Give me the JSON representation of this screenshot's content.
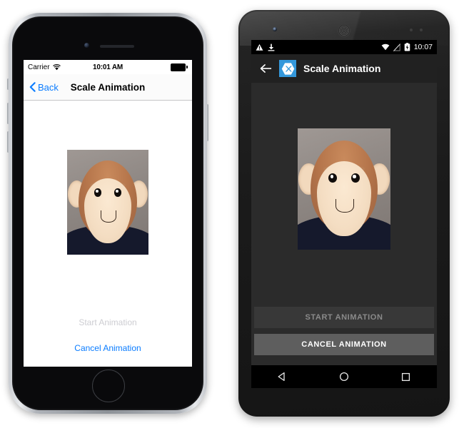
{
  "page": {
    "title": "Scale Animation — iOS and Android side by side"
  },
  "ios": {
    "status_bar": {
      "carrier": "Carrier",
      "wifi_icon": "wifi-icon",
      "time": "10:01 AM",
      "battery_icon": "battery-full-icon"
    },
    "nav_bar": {
      "back_label": "Back",
      "back_icon": "chevron-left-icon",
      "title": "Scale Animation"
    },
    "content": {
      "image_alt": "monkey-photo"
    },
    "actions": {
      "start_label": "Start Animation",
      "start_enabled": false,
      "cancel_label": "Cancel Animation",
      "cancel_enabled": true
    },
    "hardware": {
      "home_button": "home-button",
      "camera": "front-camera",
      "speaker": "earpiece-speaker"
    }
  },
  "android": {
    "status_bar": {
      "warning_icon": "warning-triangle-icon",
      "download_icon": "download-icon",
      "wifi_icon": "wifi-icon",
      "signal_icon": "no-sim-icon",
      "battery_icon": "battery-charging-icon",
      "time": "10:07"
    },
    "app_bar": {
      "back_icon": "arrow-left-icon",
      "logo_icon": "xamarin-logo-icon",
      "title": "Scale Animation"
    },
    "content": {
      "image_alt": "monkey-photo"
    },
    "actions": {
      "start_label": "START ANIMATION",
      "start_enabled": false,
      "cancel_label": "CANCEL ANIMATION",
      "cancel_enabled": true
    },
    "nav_bar": {
      "back_icon": "nav-back-triangle-icon",
      "home_icon": "nav-home-circle-icon",
      "recents_icon": "nav-recents-square-icon"
    },
    "hardware": {
      "camera": "front-camera",
      "speaker": "earpiece-grille"
    }
  },
  "colors": {
    "ios_accent": "#0a7cff",
    "ios_disabled": "#cdcdd2",
    "ios_nav_bg": "#fbfbfb",
    "android_appbar": "#212121",
    "android_content_bg": "#2b2b2b",
    "android_btn_enabled": "#5e5e5e",
    "android_btn_disabled": "#383838",
    "xamarin_blue": "#3498db"
  }
}
